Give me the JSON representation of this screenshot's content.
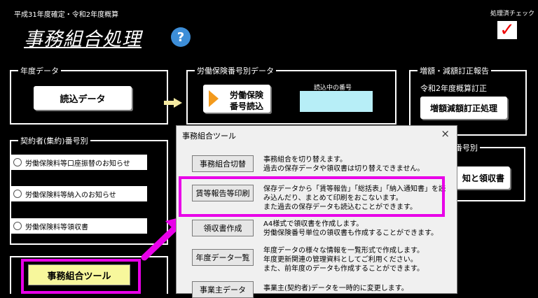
{
  "header": {
    "period": "平成31年度確定・令和2年度概算",
    "title": "事務組合処理",
    "help_icon": "?",
    "check_label": "処理済チェック",
    "check_mark": "✓"
  },
  "nendo": {
    "legend": "年度データ",
    "read_button": "読込データ"
  },
  "rodo": {
    "legend": "労働保険番号別データ",
    "read_button_line1": "労働保険",
    "read_button_line2": "番号読込",
    "current_label": "読込中の番号",
    "current_value": ""
  },
  "zogaku": {
    "legend": "増額・減額訂正報告",
    "subtitle": "令和2年度概算訂正",
    "button": "増額減額訂正処理"
  },
  "keiyaku": {
    "legend": "契約者(集約)番号別",
    "options": [
      "労働保険料等口座振替のお知らせ",
      "労働保険料等納入のお知らせ",
      "労働保険料等領収書"
    ]
  },
  "partial": {
    "legend_frag": "番号別",
    "button_frag": "知と領収書"
  },
  "main_button": "事務組合ツール",
  "dialog": {
    "title": "事務組合ツール",
    "close": "×",
    "items": [
      {
        "button": "事務組合切替",
        "desc": [
          "事務組合を切り替えます。",
          "過去の保存データや領収書は切り替えできません。"
        ]
      },
      {
        "button": "賃等報告等印刷",
        "desc": [
          "保存データから「賃等報告」「総括表」「納入通知書」を読",
          "み込んだり、まとめて印刷をおこないます。",
          "また過去の保存データも読込むことができます。"
        ]
      },
      {
        "button": "領収書作成",
        "desc": [
          "A4様式で領収書を作成します。",
          "労働保険番号単位の領収書も作成することができます。"
        ]
      },
      {
        "button": "年度データ一覧",
        "desc": [
          "年度データの様々な情報を一覧形式で作成します。",
          "年度更新関連の管理資料としてご利用ください。",
          "また、前年度のデータも作成することができます。"
        ]
      },
      {
        "button": "事業主データ",
        "desc": [
          "事業主(契約者)データを一時的に変更します。"
        ]
      }
    ]
  }
}
